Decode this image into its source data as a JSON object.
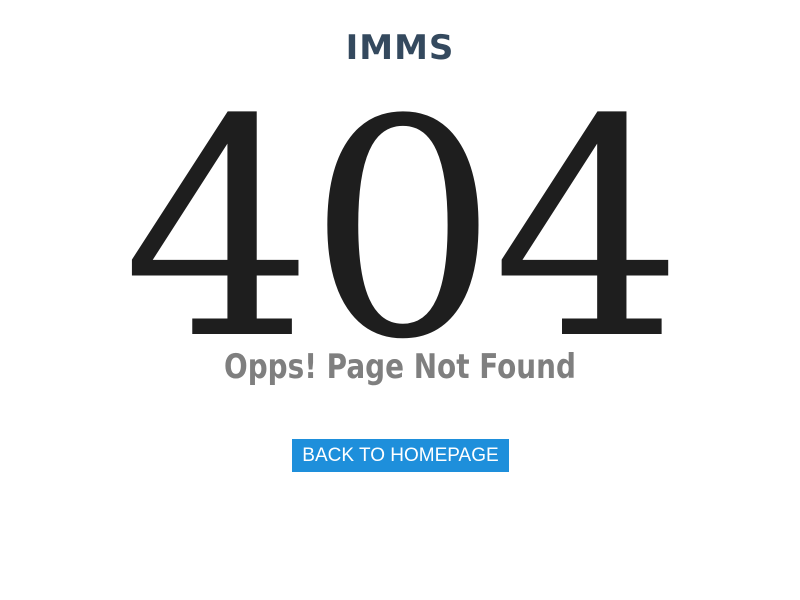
{
  "brand": {
    "name": "IMMS"
  },
  "error": {
    "code": "404",
    "message": "Opps! Page Not Found"
  },
  "actions": {
    "back_label": "BACK TO HOMEPAGE"
  },
  "colors": {
    "brand_text": "#34495e",
    "code_text": "#1e1e1e",
    "message_text": "#7f7f7f",
    "button_bg": "#1e8fdb",
    "button_text": "#ffffff"
  }
}
